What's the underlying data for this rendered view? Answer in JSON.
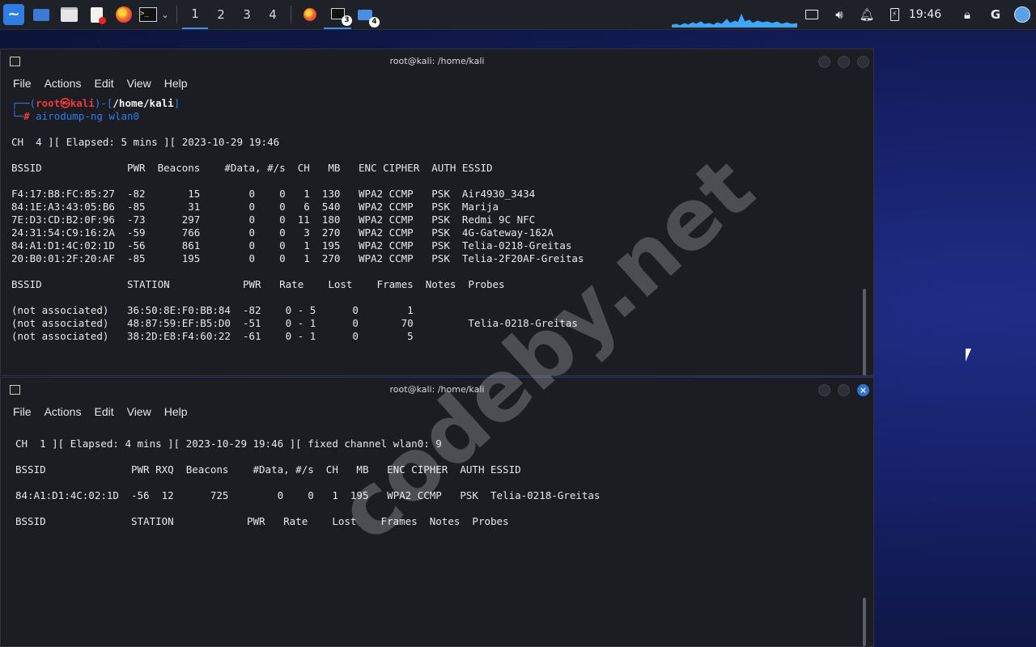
{
  "taskbar": {
    "workspaces": [
      "1",
      "2",
      "3",
      "4"
    ],
    "active_workspace": 0,
    "terminal_badge": "3",
    "files_badge": "4",
    "clock": "19:46"
  },
  "terminal1": {
    "title": "root@kali: /home/kali",
    "menu": [
      "File",
      "Actions",
      "Edit",
      "View",
      "Help"
    ],
    "prompt": {
      "box_open": "┌──(",
      "user": "root㉿kali",
      "mid": ")-[",
      "path": "/home/kali",
      "close": "]",
      "box_close": "└─",
      "hash": "#",
      "command": "airodump-ng wlan0"
    },
    "status_line": "CH  4 ][ Elapsed: 5 mins ][ 2023-10-29 19:46",
    "ap_header": "BSSID              PWR  Beacons    #Data, #/s  CH   MB   ENC CIPHER  AUTH ESSID",
    "ap_rows": [
      "F4:17:B8:FC:85:27  -82       15        0    0   1  130   WPA2 CCMP   PSK  Air4930_3434",
      "84:1E:A3:43:05:B6  -85       31        0    0   6  540   WPA2 CCMP   PSK  Marija",
      "7E:D3:CD:B2:0F:96  -73      297        0    0  11  180   WPA2 CCMP   PSK  Redmi 9C NFC",
      "24:31:54:C9:16:2A  -59      766        0    0   3  270   WPA2 CCMP   PSK  4G-Gateway-162A",
      "84:A1:D1:4C:02:1D  -56      861        0    0   1  195   WPA2 CCMP   PSK  Telia-0218-Greitas",
      "20:B0:01:2F:20:AF  -85      195        0    0   1  270   WPA2 CCMP   PSK  Telia-2F20AF-Greitas"
    ],
    "station_header": "BSSID              STATION            PWR   Rate    Lost    Frames  Notes  Probes",
    "station_rows": [
      "(not associated)   36:50:8E:F0:BB:84  -82    0 - 5      0        1",
      "(not associated)   48:87:59:EF:B5:D0  -51    0 - 1      0       70         Telia-0218-Greitas",
      "(not associated)   38:2D:E8:F4:60:22  -61    0 - 1      0        5"
    ]
  },
  "terminal2": {
    "title": "root@kali: /home/kali",
    "menu": [
      "File",
      "Actions",
      "Edit",
      "View",
      "Help"
    ],
    "status_line": "CH  1 ][ Elapsed: 4 mins ][ 2023-10-29 19:46 ][ fixed channel wlan0: 9",
    "ap_header": "BSSID              PWR RXQ  Beacons    #Data, #/s  CH   MB   ENC CIPHER  AUTH ESSID",
    "ap_rows": [
      "84:A1:D1:4C:02:1D  -56  12      725        0    0   1  195   WPA2 CCMP   PSK  Telia-0218-Greitas"
    ],
    "station_header": "BSSID              STATION            PWR   Rate    Lost    Frames  Notes  Probes",
    "close_glyph": "×"
  },
  "watermark": "codeby.net",
  "colors": {
    "accent": "#2f7de1",
    "prompt_red": "#ee3a3a",
    "command_green": "#4fd15d",
    "terminal_bg": "#1b1d23"
  }
}
